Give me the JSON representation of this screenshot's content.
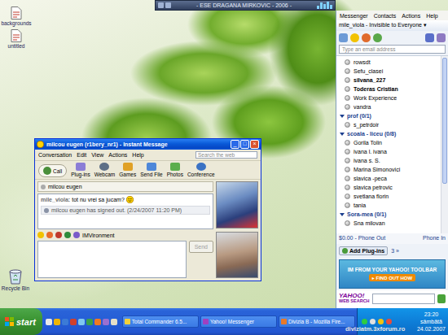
{
  "desktop": {
    "icons": [
      {
        "label": "backgrounds",
        "kind": "file"
      },
      {
        "label": "untitled",
        "kind": "file"
      },
      {
        "label": "Recycle Bin",
        "kind": "recycle-bin"
      }
    ]
  },
  "media_player": {
    "title": "- ESE DRAGANA MIRKOVIC - 2006 -"
  },
  "messenger": {
    "menu": [
      "Messenger",
      "Contacts",
      "Actions",
      "Help"
    ],
    "status_line": "mile_viola - Invisible to Everyone ▾",
    "search": {
      "placeholder": "Type an email address"
    },
    "contacts": [
      {
        "name": "rowsdt",
        "bold": false
      },
      {
        "name": "Sefu_clasei",
        "bold": false
      },
      {
        "name": "silvana_227",
        "bold": true
      },
      {
        "name": "Toderas Cristian",
        "bold": true
      },
      {
        "name": "Work Experience",
        "bold": false
      },
      {
        "name": "vandra",
        "bold": false
      }
    ],
    "groups": [
      {
        "label": "prof (0/1)",
        "expanded": true,
        "contacts": [
          {
            "name": "s_petrdoir",
            "bold": false
          }
        ]
      },
      {
        "label": "scoala - liceu (0/8)",
        "expanded": true,
        "contacts": [
          {
            "name": "Gorila Tolin",
            "bold": false
          },
          {
            "name": "ivana l. ivana",
            "bold": false
          },
          {
            "name": "ivana s. S.",
            "bold": false
          },
          {
            "name": "Marina Simonovici",
            "bold": false
          },
          {
            "name": "slavica -peca",
            "bold": false
          },
          {
            "name": "slavica petrovic",
            "bold": false
          },
          {
            "name": "svetlana florin",
            "bold": false
          },
          {
            "name": "tania",
            "bold": false
          }
        ]
      },
      {
        "label": "Sora-mea (0/1)",
        "expanded": true,
        "contacts": [
          {
            "name": "Sna milovan",
            "bold": false
          }
        ]
      }
    ],
    "phone_out": "$0.00 - Phone Out",
    "phone_in": "Phone In",
    "plugins": {
      "label": "Add Plug-ins",
      "count": "3 »"
    },
    "ad": {
      "text": "IM FROM YOUR YAHOO! TOOLBAR",
      "button": "▸ FIND OUT HOW"
    },
    "web_search": {
      "brand": "YAHOO!",
      "label": "WEB SEARCH"
    }
  },
  "im_window": {
    "title": "milcou eugen (r1bery_nr1) - Instant Message",
    "controls": [
      "_",
      "□",
      "×"
    ],
    "menu": [
      "Conversation",
      "Edit",
      "View",
      "Actions",
      "Help"
    ],
    "search": {
      "placeholder": "Search the web"
    },
    "toolbar": [
      {
        "label": "Call"
      },
      {
        "label": "Plug-ins"
      },
      {
        "label": "Webcam"
      },
      {
        "label": "Games"
      },
      {
        "label": "Send File"
      },
      {
        "label": "Photos"
      },
      {
        "label": "Conference"
      }
    ],
    "to": "milcou eugen",
    "messages": [
      {
        "kind": "message",
        "sender": "mile_viola:",
        "text": "tot nu vrei sa jucam?"
      },
      {
        "kind": "notice",
        "sender": "",
        "text": "milcou eugen has signed out. (2/24/2007 11:20 PM)"
      }
    ],
    "imvironment": "IMVironment",
    "send": {
      "label": "Send",
      "disabled": true
    }
  },
  "taskbar": {
    "start": "start",
    "tasks": [
      {
        "label": "Total Commander 6.5...",
        "selected": false
      },
      {
        "label": "Yahoo! Messenger",
        "selected": false
      },
      {
        "label": "Divizia B - Mozilla Fire...",
        "selected": false
      }
    ],
    "clock": {
      "time": "23:20",
      "day": "sâmbătă",
      "date": "24.02.2007"
    }
  },
  "watermark": "diviziatm.3xforum.ro"
}
